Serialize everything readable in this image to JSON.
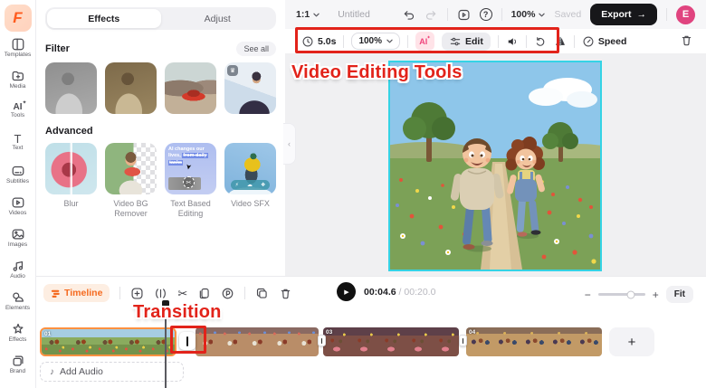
{
  "colors": {
    "accent_orange": "#F56A1F",
    "annotation_red": "#E2231A",
    "selection_cyan": "#35D3E5",
    "avatar_pink": "#E0447F",
    "export_black": "#17171A"
  },
  "sidebar": {
    "logo": "F",
    "items": [
      {
        "label": "Templates"
      },
      {
        "label": "Media"
      },
      {
        "label": "Tools"
      },
      {
        "label": "Text"
      },
      {
        "label": "Subtitles"
      },
      {
        "label": "Videos"
      },
      {
        "label": "Images"
      },
      {
        "label": "Audio"
      },
      {
        "label": "Elements"
      },
      {
        "label": "Effects"
      },
      {
        "label": "Brand"
      }
    ]
  },
  "panel": {
    "tab_effects": "Effects",
    "tab_adjust": "Adjust",
    "filter_title": "Filter",
    "see_all": "See all",
    "advanced_title": "Advanced",
    "advanced": [
      {
        "label": "Blur"
      },
      {
        "label": "Video BG Remover"
      },
      {
        "label": "Text Based Editing"
      },
      {
        "label": "Video SFX"
      }
    ],
    "tbe_line1": "AI changes our",
    "tbe_line2": "lives, ",
    "tbe_struck1": "from daily",
    "tbe_struck2": "tasks"
  },
  "topbar": {
    "ratio": "1:1",
    "title": "Untitled",
    "zoom": "100%",
    "saved": "Saved",
    "export": "Export",
    "export_arrow": "→",
    "avatar": "E"
  },
  "tools": {
    "duration": "5.0s",
    "zoom": "100%",
    "ai": "AI",
    "edit": "Edit",
    "speed": "Speed"
  },
  "annotations": {
    "tools_label": "Video Editing Tools",
    "transition_label": "Transition"
  },
  "timeline": {
    "button": "Timeline",
    "current_time": "00:04.6",
    "separator": " / ",
    "total_time": "00:20.0",
    "fit": "Fit",
    "add_audio": "Add Audio",
    "add_clip": "+",
    "clips": [
      {
        "label": "01"
      },
      {
        "label": ""
      },
      {
        "label": "03"
      },
      {
        "label": "04"
      }
    ]
  }
}
